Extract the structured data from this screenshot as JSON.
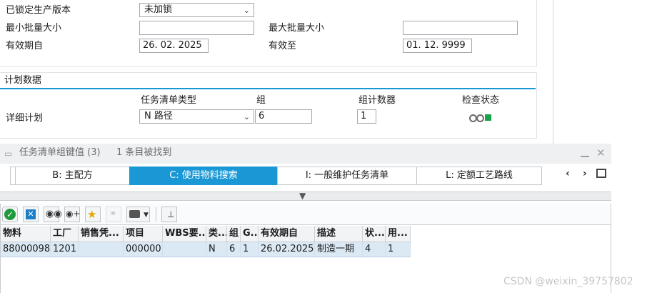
{
  "header": {
    "locked_version_label": "已锁定生产版本",
    "locked_version_value": "未加锁",
    "min_lot_label": "最小批量大小",
    "min_lot_value": "",
    "max_lot_label": "最大批量大小",
    "max_lot_value": "",
    "valid_from_label": "有效期自",
    "valid_from_value": "26. 02. 2025",
    "valid_to_label": "有效至",
    "valid_to_value": "01. 12. 9999"
  },
  "planning": {
    "section_title": "计划数据",
    "col_task_list_type": "任务清单类型",
    "col_group": "组",
    "col_group_counter": "组计数器",
    "col_check_status": "检查状态",
    "row_label": "详细计划",
    "task_list_type_value": "N 路径",
    "group_value": "6",
    "group_counter_value": "1",
    "status_colors": [
      "#6b6b6b",
      "#6b6b6b",
      "#17a34a"
    ]
  },
  "popup": {
    "title": "任务清单组键值 (3)",
    "subtitle": "1 条目被找到",
    "tabs": [
      {
        "label": "B: 主配方"
      },
      {
        "label": "C: 使用物料搜索"
      },
      {
        "label": "I: 一般维护任务清单"
      },
      {
        "label": "L: 定额工艺路线"
      }
    ],
    "toolbar_icons": [
      "check-icon",
      "cancel-icon",
      "binoculars-icon",
      "binoculars-plus-icon",
      "favorite-add-icon",
      "link-icon",
      "print-icon",
      "pin-icon"
    ],
    "table": {
      "headers": [
        "物料",
        "工厂",
        "销售凭...",
        "项目",
        "WBS要...",
        "类...",
        "组",
        "G...",
        "有效期自",
        "描述",
        "状...",
        "用..."
      ],
      "rows": [
        [
          "88000098",
          "1201",
          "",
          "000000",
          "",
          "N",
          "6",
          "1",
          "26.02.2025",
          "制造一期",
          "4",
          "1"
        ]
      ]
    }
  },
  "watermark": "CSDN @weixin_39757802"
}
